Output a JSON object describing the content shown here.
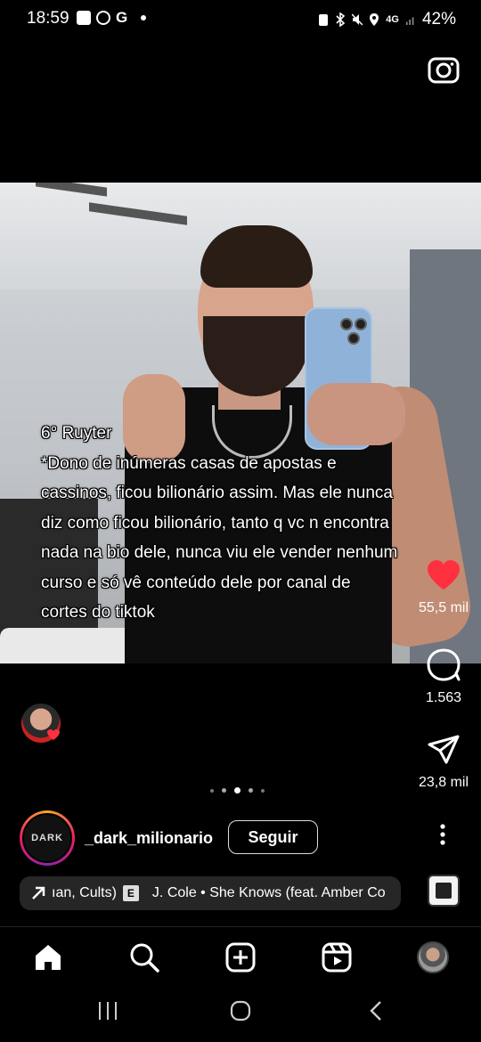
{
  "status_bar": {
    "time": "18:59",
    "network": "4G",
    "battery": "42%"
  },
  "header": {
    "camera_icon": "camera-icon"
  },
  "reel": {
    "caption_lines": [
      "6° Ruyter",
      "*Dono de inúmeras casas de apostas e",
      "cassinos, ficou bilionário assim. Mas ele nunca",
      "diz como ficou bilionário, tanto q vc n encontra",
      "nada na bio dele, nunca viu ele vender nenhum",
      "curso e só vê conteúdo dele por canal de",
      "cortes do tiktok"
    ],
    "pagination": {
      "count": 5,
      "active_index": 2
    }
  },
  "actions": {
    "likes": "55,5 mil",
    "comments": "1.563",
    "shares": "23,8 mil",
    "like_color": "#ff3040"
  },
  "account": {
    "avatar_text": "DARK",
    "username": "_dark_milionario",
    "follow_label": "Seguir"
  },
  "music": {
    "artists": "ıan, Cults)",
    "explicit_badge": "E",
    "title": "J. Cole • She Knows (feat. Amber Co"
  },
  "bottom_nav": {
    "items": [
      "home-icon",
      "search-icon",
      "create-icon",
      "reels-icon",
      "profile-avatar"
    ]
  },
  "system_nav": {
    "items": [
      "recents-icon",
      "home-circle-icon",
      "back-icon"
    ]
  }
}
